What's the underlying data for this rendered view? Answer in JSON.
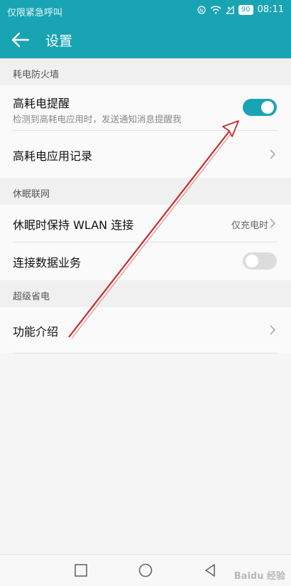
{
  "status_bar": {
    "left_text": "仅限紧急呼叫",
    "battery": "90",
    "time": "08:11"
  },
  "app_bar": {
    "title": "设置"
  },
  "sections": {
    "power_firewall": "耗电防火墙",
    "sleep_network": "休眠联网",
    "super_saver": "超级省电"
  },
  "rows": {
    "high_power_alert": {
      "title": "高耗电提醒",
      "subtitle": "检测到高耗电应用时，发送通知消息提醒我",
      "enabled": true
    },
    "high_power_log": {
      "title": "高耗电应用记录"
    },
    "keep_wlan": {
      "title": "休眠时保持 WLAN 连接",
      "value": "仅充电时"
    },
    "mobile_data": {
      "title": "连接数据业务",
      "enabled": false
    },
    "feature_intro": {
      "title": "功能介绍"
    }
  },
  "watermark": "Baidu 经验",
  "colors": {
    "accent": "#19a4b3",
    "annotation": "#cc2a2a"
  }
}
